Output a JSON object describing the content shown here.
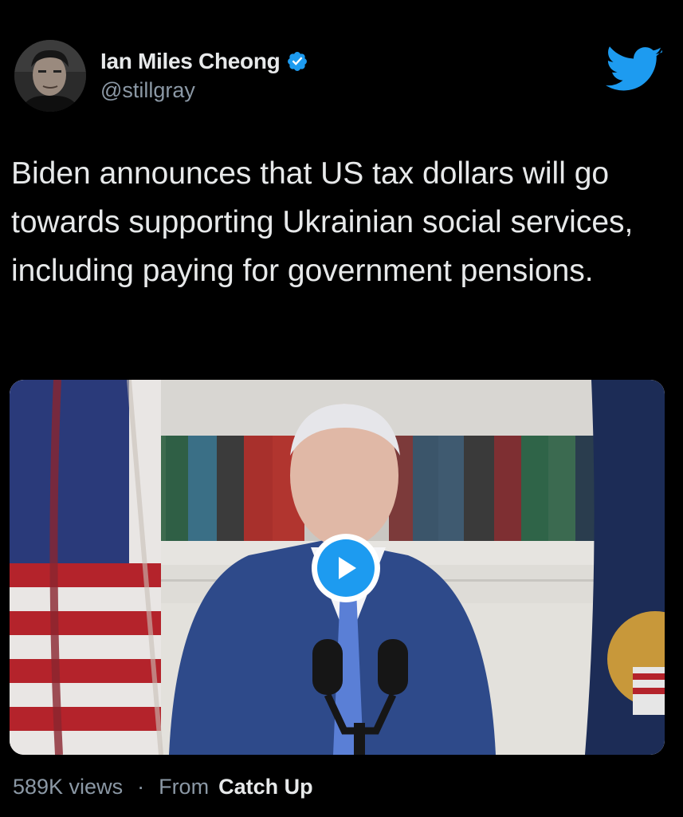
{
  "author": {
    "display_name": "Ian Miles Cheong",
    "handle": "@stillgray",
    "verified": true
  },
  "tweet": {
    "text": "Biden announces that US tax dollars will go towards supporting Ukrainian social services, including paying for government pensions."
  },
  "media": {
    "type": "video",
    "play_icon": "play-icon"
  },
  "footer": {
    "views": "589K views",
    "separator": "·",
    "from_label": "From",
    "source": "Catch Up"
  },
  "colors": {
    "background": "#000000",
    "text": "#e7e9ea",
    "secondary_text": "#8b98a5",
    "accent": "#1d9bf0"
  }
}
